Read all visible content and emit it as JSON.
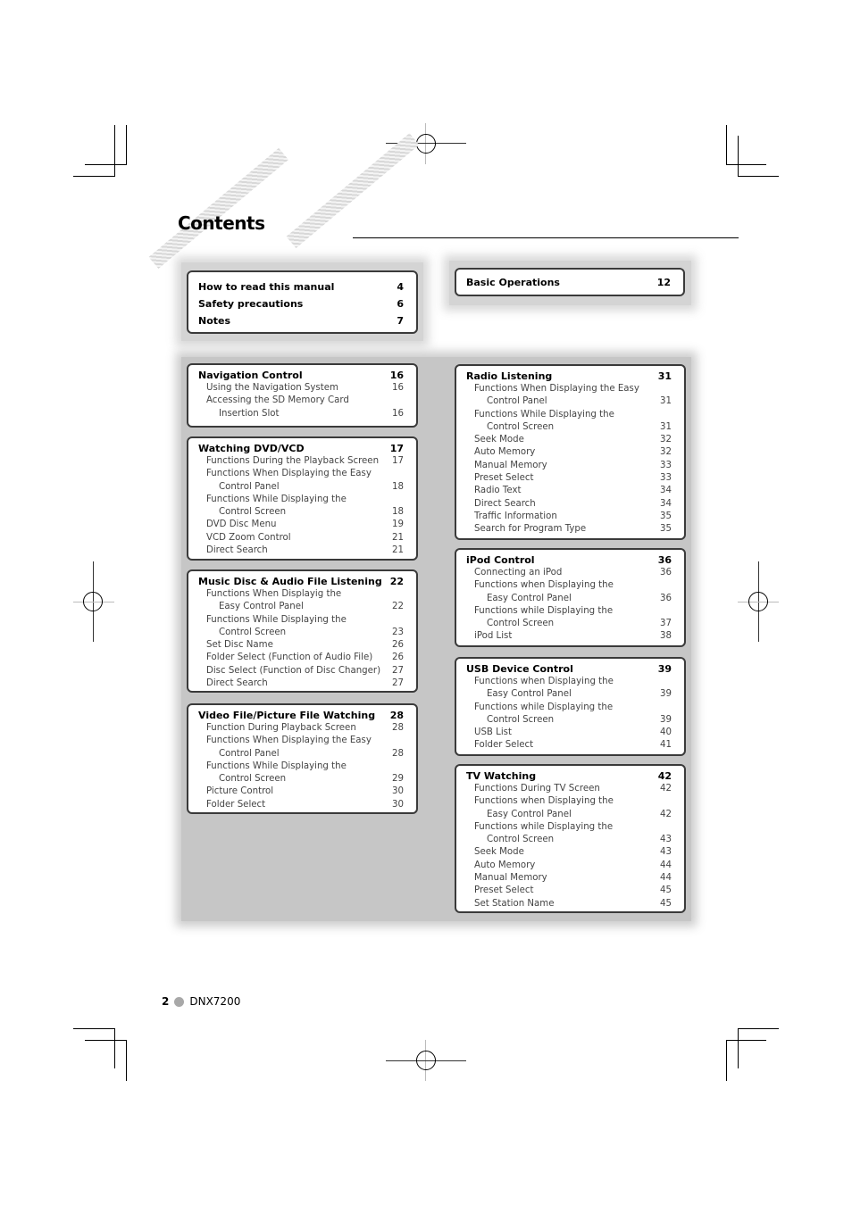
{
  "page": {
    "title": "Contents",
    "footer": {
      "page_number": "2",
      "model": "DNX7200",
      "bullet_icon": "gray-circle-icon"
    }
  },
  "top_left_box": {
    "items": [
      {
        "label": "How to read this manual",
        "page": "4"
      },
      {
        "label": "Safety precautions",
        "page": "6"
      },
      {
        "label": "Notes",
        "page": "7"
      }
    ]
  },
  "top_right_box": {
    "items": [
      {
        "label": "Basic Operations",
        "page": "12"
      }
    ]
  },
  "sections": {
    "navigation": {
      "title": "Navigation Control",
      "page": "16",
      "items": [
        {
          "label": "Using the Navigation System",
          "cont": "",
          "page": "16"
        },
        {
          "label": "Accessing the SD Memory Card",
          "cont": "Insertion Slot",
          "page": "16"
        }
      ]
    },
    "dvd": {
      "title": "Watching DVD/VCD",
      "page": "17",
      "items": [
        {
          "label": "Functions During the Playback Screen",
          "cont": "",
          "page": "17"
        },
        {
          "label": "Functions When Displaying the Easy",
          "cont": "Control Panel",
          "page": "18"
        },
        {
          "label": "Functions While Displaying the",
          "cont": "Control Screen",
          "page": "18"
        },
        {
          "label": "DVD Disc Menu",
          "cont": "",
          "page": "19"
        },
        {
          "label": "VCD Zoom Control",
          "cont": "",
          "page": "21"
        },
        {
          "label": "Direct Search",
          "cont": "",
          "page": "21"
        }
      ]
    },
    "music": {
      "title": "Music Disc & Audio File Listening",
      "page": "22",
      "items": [
        {
          "label": "Functions When Displayig the",
          "cont": "Easy Control Panel",
          "page": "22"
        },
        {
          "label": "Functions While Displaying the",
          "cont": "Control Screen",
          "page": "23"
        },
        {
          "label": "Set Disc Name",
          "cont": "",
          "page": "26"
        },
        {
          "label": "Folder Select (Function of Audio File)",
          "cont": "",
          "page": "26"
        },
        {
          "label": "Disc Select (Function of Disc Changer)",
          "cont": "",
          "page": "27"
        },
        {
          "label": "Direct Search",
          "cont": "",
          "page": "27"
        }
      ]
    },
    "video": {
      "title": "Video File/Picture File Watching",
      "page": "28",
      "items": [
        {
          "label": "Function During Playback Screen",
          "cont": "",
          "page": "28"
        },
        {
          "label": "Functions When Displaying the Easy",
          "cont": "Control Panel",
          "page": "28"
        },
        {
          "label": "Functions While Displaying the",
          "cont": "Control Screen",
          "page": "29"
        },
        {
          "label": "Picture Control",
          "cont": "",
          "page": "30"
        },
        {
          "label": "Folder Select",
          "cont": "",
          "page": "30"
        }
      ]
    },
    "radio": {
      "title": "Radio Listening",
      "page": "31",
      "items": [
        {
          "label": "Functions When Displaying the Easy",
          "cont": "Control Panel",
          "page": "31"
        },
        {
          "label": "Functions While Displaying the",
          "cont": "Control Screen",
          "page": "31"
        },
        {
          "label": "Seek Mode",
          "cont": "",
          "page": "32"
        },
        {
          "label": "Auto Memory",
          "cont": "",
          "page": "32"
        },
        {
          "label": "Manual Memory",
          "cont": "",
          "page": "33"
        },
        {
          "label": "Preset Select",
          "cont": "",
          "page": "33"
        },
        {
          "label": "Radio Text",
          "cont": "",
          "page": "34"
        },
        {
          "label": "Direct Search",
          "cont": "",
          "page": "34"
        },
        {
          "label": "Traffic Information",
          "cont": "",
          "page": "35"
        },
        {
          "label": "Search for Program Type",
          "cont": "",
          "page": "35"
        }
      ]
    },
    "ipod": {
      "title": "iPod Control",
      "page": "36",
      "items": [
        {
          "label": "Connecting an iPod",
          "cont": "",
          "page": "36"
        },
        {
          "label": "Functions when Displaying the",
          "cont": "Easy Control Panel",
          "page": "36"
        },
        {
          "label": "Functions while Displaying the",
          "cont": "Control Screen",
          "page": "37"
        },
        {
          "label": "iPod List",
          "cont": "",
          "page": "38"
        }
      ]
    },
    "usb": {
      "title": "USB Device Control",
      "page": "39",
      "items": [
        {
          "label": "Functions when Displaying the",
          "cont": "Easy Control Panel",
          "page": "39"
        },
        {
          "label": "Functions while Displaying the",
          "cont": "Control Screen",
          "page": "39"
        },
        {
          "label": "USB List",
          "cont": "",
          "page": "40"
        },
        {
          "label": "Folder Select",
          "cont": "",
          "page": "41"
        }
      ]
    },
    "tv": {
      "title": "TV Watching",
      "page": "42",
      "items": [
        {
          "label": "Functions During TV Screen",
          "cont": "",
          "page": "42"
        },
        {
          "label": "Functions when Displaying the",
          "cont": "Easy Control Panel",
          "page": "42"
        },
        {
          "label": "Functions while Displaying the",
          "cont": "Control Screen",
          "page": "43"
        },
        {
          "label": "Seek Mode",
          "cont": "",
          "page": "43"
        },
        {
          "label": "Auto Memory",
          "cont": "",
          "page": "44"
        },
        {
          "label": "Manual Memory",
          "cont": "",
          "page": "44"
        },
        {
          "label": "Preset Select",
          "cont": "",
          "page": "45"
        },
        {
          "label": "Set Station Name",
          "cont": "",
          "page": "45"
        }
      ]
    }
  }
}
